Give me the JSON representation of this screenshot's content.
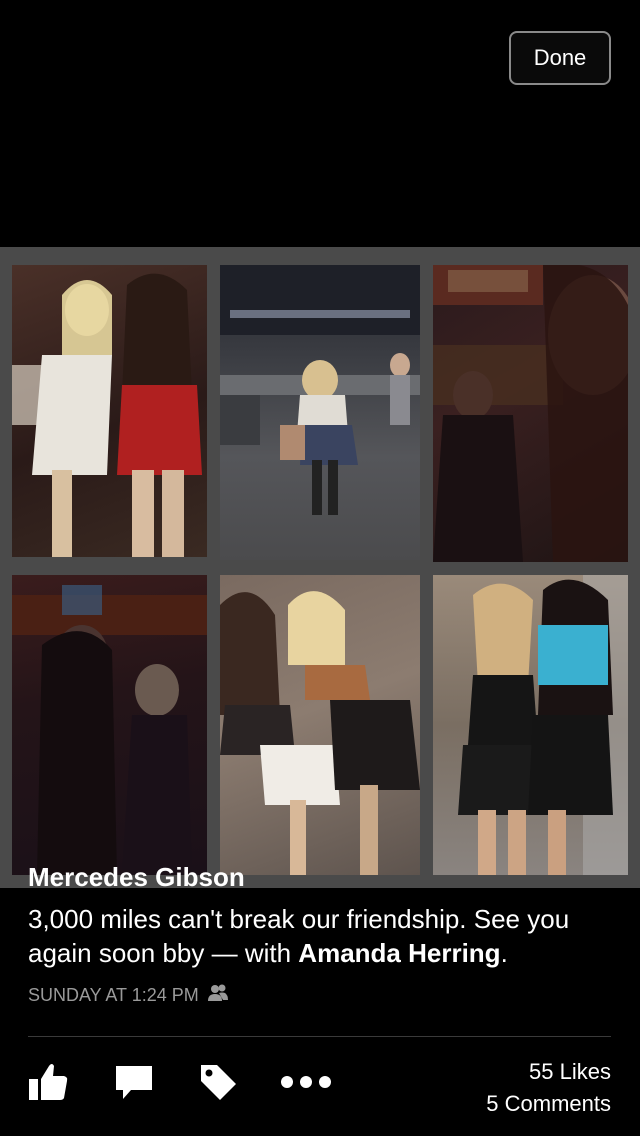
{
  "header": {
    "done_label": "Done"
  },
  "post": {
    "author": "Mercedes Gibson",
    "message": "3,000 miles can't break our friendship. See you again soon bby",
    "with_prefix": " — with ",
    "tagged_name": "Amanda Herring",
    "suffix": ".",
    "timestamp": "SUNDAY AT 1:24 PM",
    "privacy_icon": "friends-icon"
  },
  "photos": [
    "collage-photo-1",
    "collage-photo-2",
    "collage-photo-3",
    "collage-photo-4",
    "collage-photo-5",
    "collage-photo-6"
  ],
  "actions": {
    "icons": [
      "like-icon",
      "comment-icon",
      "tag-icon",
      "more-icon"
    ]
  },
  "stats": {
    "likes": "55 Likes",
    "comments": "5 Comments"
  }
}
